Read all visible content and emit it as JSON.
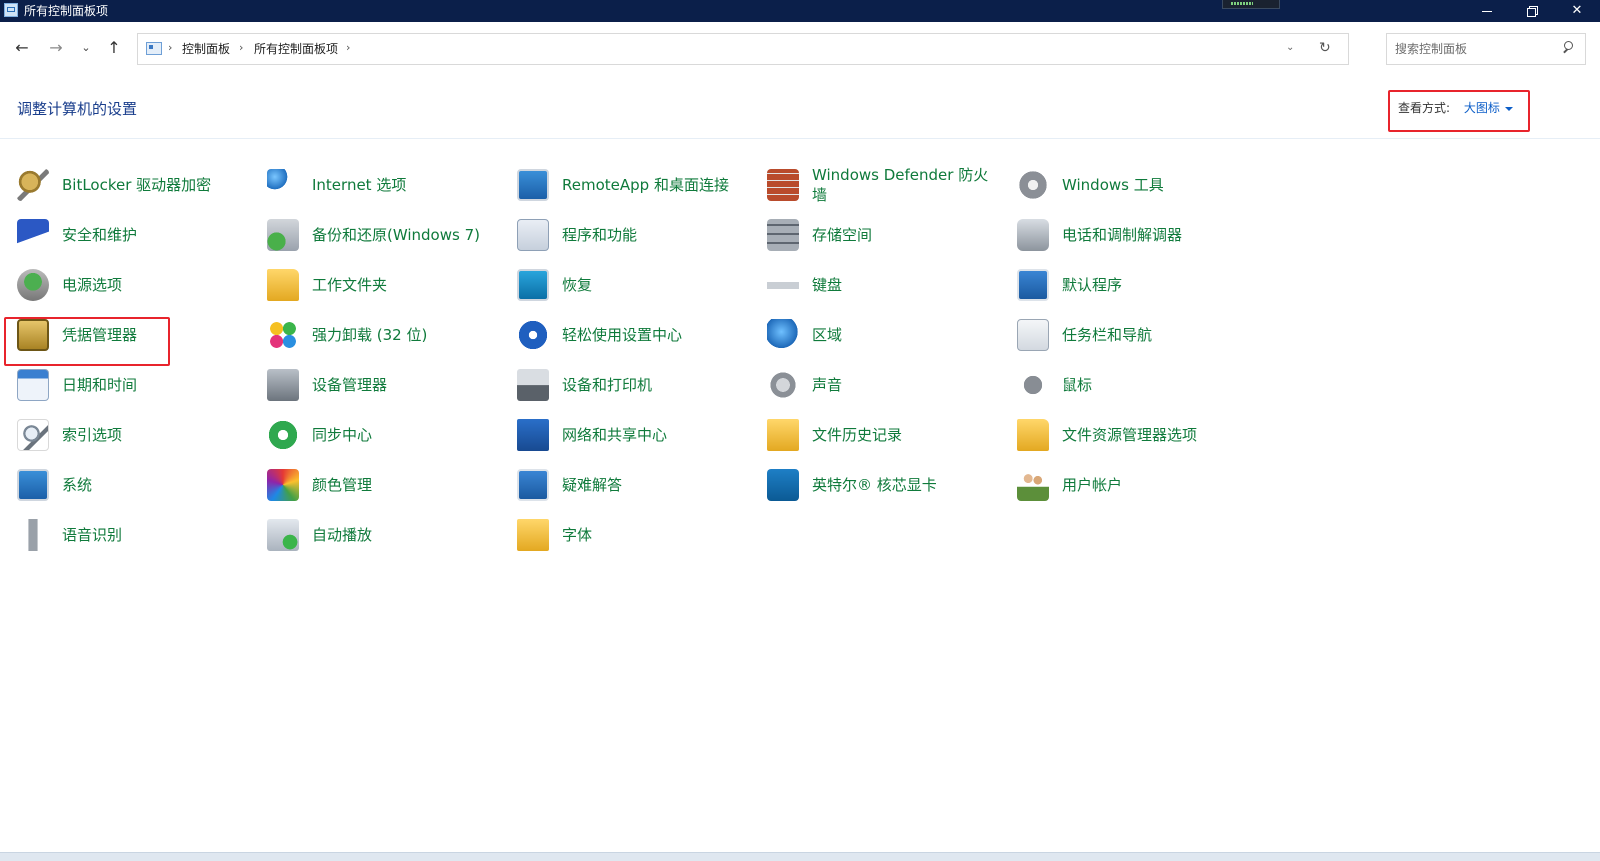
{
  "window": {
    "title": "所有控制面板项",
    "minimize_icon": "minimize-icon",
    "maximize_icon": "restore-icon",
    "close_icon": "close-icon"
  },
  "nav": {
    "breadcrumb": [
      "控制面板",
      "所有控制面板项"
    ],
    "search_placeholder": "搜索控制面板"
  },
  "header": {
    "title": "调整计算机的设置",
    "view_by_label": "查看方式:",
    "view_by_value": "大图标"
  },
  "colors": {
    "accent": "#0c5ec8",
    "item_text": "#0f7a3b",
    "highlight": "#e8242c",
    "titlebar": "#0b1f4a"
  },
  "items": [
    {
      "label": "BitLocker 驱动器加密",
      "icon": "key"
    },
    {
      "label": "Internet 选项",
      "icon": "globe-list"
    },
    {
      "label": "RemoteApp 和桌面连接",
      "icon": "monitor-net"
    },
    {
      "label": "Windows Defender 防火墙",
      "icon": "firewall"
    },
    {
      "label": "Windows 工具",
      "icon": "gear"
    },
    {
      "label": "安全和维护",
      "icon": "flag"
    },
    {
      "label": "备份和还原(Windows 7)",
      "icon": "backup"
    },
    {
      "label": "程序和功能",
      "icon": "programs"
    },
    {
      "label": "存储空间",
      "icon": "storage"
    },
    {
      "label": "电话和调制解调器",
      "icon": "modem"
    },
    {
      "label": "电源选项",
      "icon": "battery"
    },
    {
      "label": "工作文件夹",
      "icon": "folder"
    },
    {
      "label": "恢复",
      "icon": "recover"
    },
    {
      "label": "键盘",
      "icon": "keyboard"
    },
    {
      "label": "默认程序",
      "icon": "defaults"
    },
    {
      "label": "凭据管理器",
      "icon": "safe"
    },
    {
      "label": "强力卸载 (32 位)",
      "icon": "clover"
    },
    {
      "label": "轻松使用设置中心",
      "icon": "ease"
    },
    {
      "label": "区域",
      "icon": "region"
    },
    {
      "label": "任务栏和导航",
      "icon": "taskbar"
    },
    {
      "label": "日期和时间",
      "icon": "calendar"
    },
    {
      "label": "设备管理器",
      "icon": "devmgr"
    },
    {
      "label": "设备和打印机",
      "icon": "printer"
    },
    {
      "label": "声音",
      "icon": "speaker"
    },
    {
      "label": "鼠标",
      "icon": "mouse"
    },
    {
      "label": "索引选项",
      "icon": "search"
    },
    {
      "label": "同步中心",
      "icon": "sync"
    },
    {
      "label": "网络和共享中心",
      "icon": "network"
    },
    {
      "label": "文件历史记录",
      "icon": "history"
    },
    {
      "label": "文件资源管理器选项",
      "icon": "explorer-opt"
    },
    {
      "label": "系统",
      "icon": "system"
    },
    {
      "label": "颜色管理",
      "icon": "color"
    },
    {
      "label": "疑难解答",
      "icon": "trouble"
    },
    {
      "label": "英特尔® 核芯显卡",
      "icon": "intel"
    },
    {
      "label": "用户帐户",
      "icon": "users"
    },
    {
      "label": "语音识别",
      "icon": "mic"
    },
    {
      "label": "自动播放",
      "icon": "autoplay"
    },
    {
      "label": "字体",
      "icon": "font"
    }
  ]
}
